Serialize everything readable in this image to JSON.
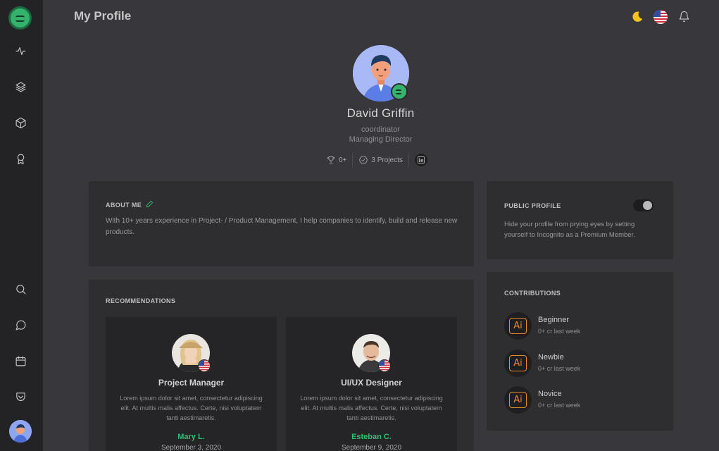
{
  "header": {
    "title": "My Profile"
  },
  "profile": {
    "name": "David Griffin",
    "role": "coordinator",
    "title": "Managing Director",
    "awards": "0+",
    "projects": "3 Projects"
  },
  "about": {
    "label": "ABOUT ME",
    "text": "With 10+ years experience in Project- / Product Management, I help companies to identify, build and release new products."
  },
  "public_profile": {
    "label": "PUBLIC PROFILE",
    "text": "Hide your profile from prying eyes by setting yourself to Incognito as a Premium Member.",
    "enabled": true
  },
  "recommendations": {
    "label": "RECOMMENDATIONS",
    "items": [
      {
        "role": "Project Manager",
        "text": "Lorem ipsum dolor sit amet, consectetur adipiscing elit. At multis malis affectus. Certe, nisi voluptatem tanti aestimaretis.",
        "name": "Mary L.",
        "date": "September 3, 2020"
      },
      {
        "role": "UI/UX Designer",
        "text": "Lorem ipsum dolor sit amet, consectetur adipiscing elit. At multis malis affectus. Certe, nisi voluptatem tanti aestimaretis.",
        "name": "Esteban C.",
        "date": "September 9, 2020"
      }
    ]
  },
  "contributions": {
    "label": "CONTRIBUTIONS",
    "items": [
      {
        "icon": "Ai",
        "title": "Beginner",
        "sub": "0+ cr last week"
      },
      {
        "icon": "Ai",
        "title": "Newbie",
        "sub": "0+ cr last week"
      },
      {
        "icon": "Ai",
        "title": "Novice",
        "sub": "0+ cr last week"
      }
    ]
  },
  "colors": {
    "accent": "#2fbf71",
    "background": "#38383c",
    "sidebar": "#232326",
    "card": "#2e2e31"
  }
}
